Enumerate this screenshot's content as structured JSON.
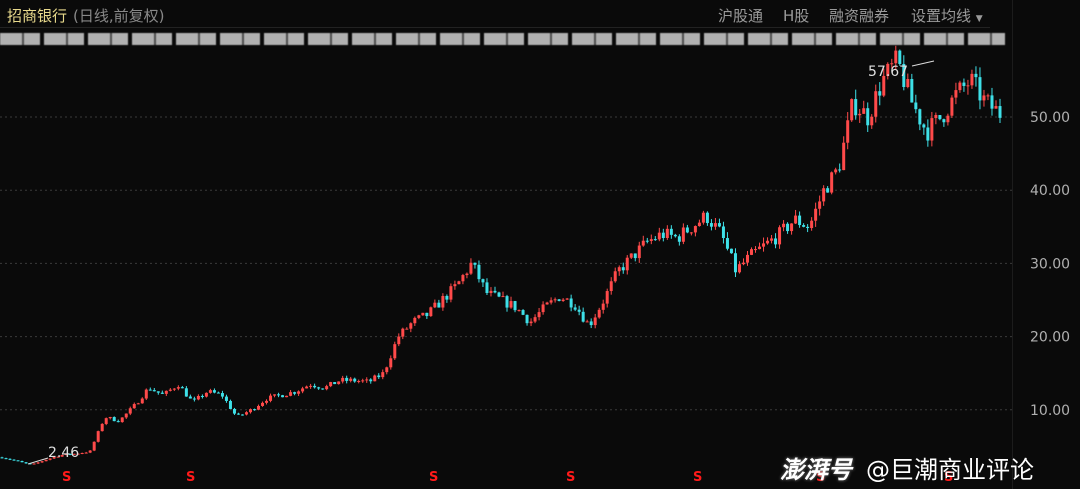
{
  "header": {
    "title": "招商银行",
    "subtitle": "(日线,前复权)",
    "tools": [
      "沪股通",
      "H股",
      "融资融券",
      "设置均线"
    ],
    "dropdown_icon": "caret-down-icon"
  },
  "colors": {
    "up": "#ff4a4a",
    "down": "#3ee0e8",
    "grid": "#3a3a3a",
    "marker": "#ff1a1a"
  },
  "chart_data": {
    "type": "candlestick",
    "title": "招商银行 (日线,前复权)",
    "ylim": [
      0,
      60
    ],
    "yticks": [
      10,
      20,
      30,
      40,
      50
    ],
    "ytick_labels": [
      "10.00",
      "20.00",
      "30.00",
      "40.00",
      "50.00"
    ],
    "grid": "horizontal dashed",
    "annotations": {
      "low": "2.46",
      "high": "57.67"
    },
    "close_keypoints": [
      3.5,
      3.0,
      2.46,
      3.2,
      3.8,
      4.0,
      4.3,
      9.0,
      8.5,
      10.5,
      13.0,
      12.0,
      13.5,
      11.0,
      12.5,
      12.0,
      9.0,
      10.0,
      11.5,
      12.0,
      12.5,
      13.5,
      13.0,
      14.0,
      14.0,
      13.8,
      15.0,
      20.0,
      22.0,
      23.0,
      25.0,
      27.0,
      30.0,
      26.0,
      25.0,
      24.0,
      22.0,
      24.0,
      25.5,
      24.5,
      21.5,
      25.0,
      29.0,
      31.0,
      33.0,
      34.0,
      33.5,
      35.0,
      36.5,
      34.0,
      29.0,
      31.0,
      32.5,
      34.0,
      36.0,
      35.0,
      40.0,
      43.0,
      52.0,
      50.0,
      55.0,
      57.67,
      52.0,
      48.0,
      50.0,
      53.0,
      55.0,
      52.0,
      50.5
    ],
    "markers": {
      "label": "S",
      "count": 7
    }
  },
  "watermark": {
    "logo": "澎湃号",
    "author": "@巨潮商业评论"
  }
}
